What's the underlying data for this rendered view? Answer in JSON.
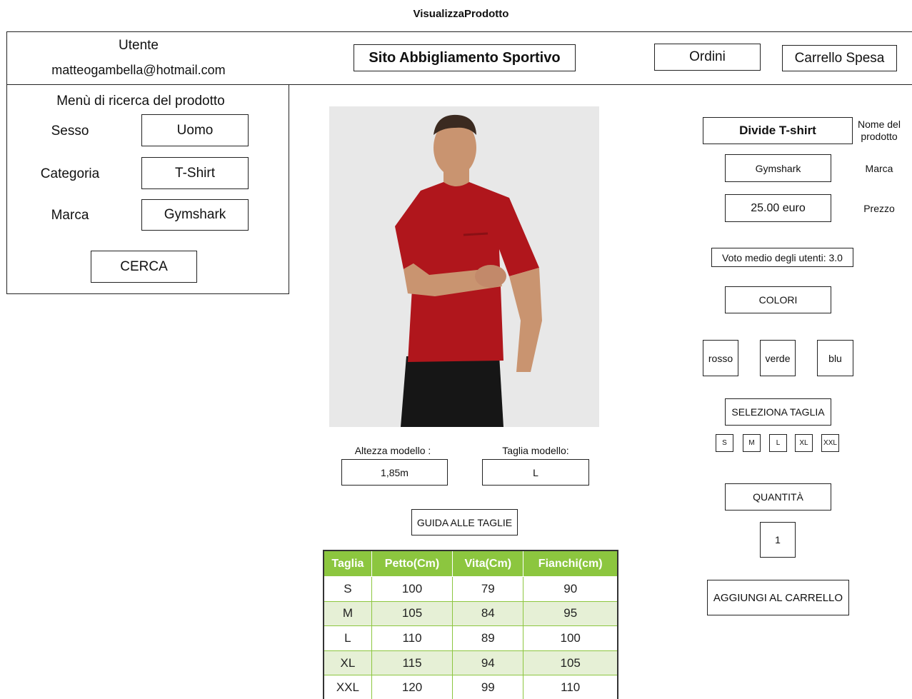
{
  "page_title": "VisualizzaProdotto",
  "header": {
    "user_label": "Utente",
    "user_email": "matteogambella@hotmail.com",
    "site_title": "Sito Abbigliamento Sportivo",
    "orders_label": "Ordini",
    "cart_label": "Carrello Spesa"
  },
  "search_menu": {
    "title": "Menù di ricerca del prodotto",
    "sex_label": "Sesso",
    "sex_value": "Uomo",
    "category_label": "Categoria",
    "category_value": "T-Shirt",
    "brand_label": "Marca",
    "brand_value": "Gymshark",
    "search_button": "CERCA"
  },
  "product_image": {
    "shirt_color": "#b0161c",
    "background_color": "#e8e8e8"
  },
  "model_info": {
    "height_label": "Altezza modello :",
    "height_value": "1,85m",
    "size_label": "Taglia modello:",
    "size_value": "L"
  },
  "size_guide_button": "GUIDA ALLE TAGLIE",
  "size_table": {
    "header_color": "#8cc63f",
    "columns": [
      "Taglia",
      "Petto(Cm)",
      "Vita(Cm)",
      "Fianchi(cm)"
    ],
    "rows": [
      [
        "S",
        "100",
        "79",
        "90"
      ],
      [
        "M",
        "105",
        "84",
        "95"
      ],
      [
        "L",
        "110",
        "89",
        "100"
      ],
      [
        "XL",
        "115",
        "94",
        "105"
      ],
      [
        "XXL",
        "120",
        "99",
        "110"
      ]
    ]
  },
  "product": {
    "name": "Divide T-shirt",
    "name_label": "Nome del prodotto",
    "brand": "Gymshark",
    "brand_label": "Marca",
    "price": "25.00 euro",
    "price_label": "Prezzo",
    "rating": "Voto medio degli utenti: 3.0",
    "colors_button": "COLORI",
    "colors": [
      "rosso",
      "verde",
      "blu"
    ],
    "select_size_button": "SELEZIONA TAGLIA",
    "sizes": [
      "S",
      "M",
      "L",
      "XL",
      "XXL"
    ],
    "quantity_button": "QUANTITÀ",
    "quantity_value": "1",
    "add_to_cart_button": "AGGIUNGI AL CARRELLO"
  }
}
